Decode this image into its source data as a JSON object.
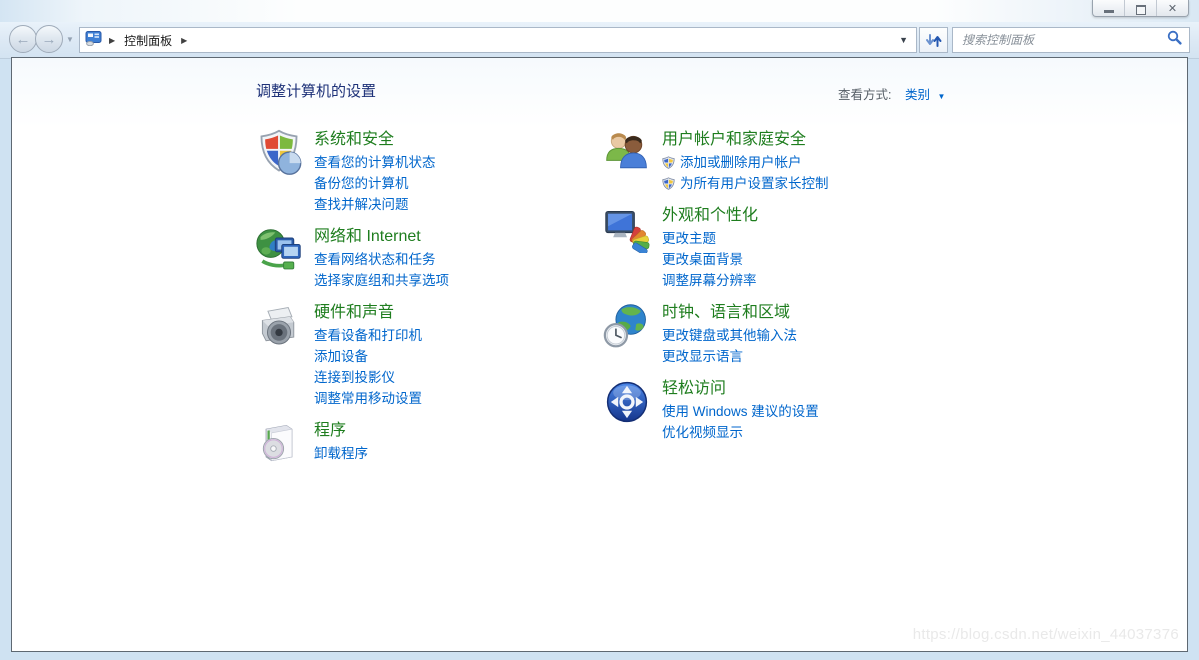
{
  "navbar": {
    "breadcrumb": {
      "label": "控制面板"
    },
    "search_placeholder": "搜索控制面板"
  },
  "content": {
    "title": "调整计算机的设置",
    "view_by_label": "查看方式:",
    "view_by_value": "类别"
  },
  "chrome_icons": [
    "minimize-icon",
    "maximize-icon",
    "close-icon",
    "back-icon",
    "forward-icon",
    "dropdown-chevron-icon",
    "control-panel-icon",
    "breadcrumb-arrow-icon",
    "refresh-icon",
    "search-icon"
  ],
  "categories": {
    "left": [
      {
        "id": "system-and-security",
        "icon": "system-security-shield-icon",
        "title": "系统和安全",
        "links": [
          {
            "label": "查看您的计算机状态"
          },
          {
            "label": "备份您的计算机"
          },
          {
            "label": "查找并解决问题"
          }
        ]
      },
      {
        "id": "network-and-internet",
        "icon": "network-internet-icon",
        "title": "网络和 Internet",
        "links": [
          {
            "label": "查看网络状态和任务"
          },
          {
            "label": "选择家庭组和共享选项"
          }
        ]
      },
      {
        "id": "hardware-and-sound",
        "icon": "hardware-sound-icon",
        "title": "硬件和声音",
        "links": [
          {
            "label": "查看设备和打印机"
          },
          {
            "label": "添加设备"
          },
          {
            "label": "连接到投影仪"
          },
          {
            "label": "调整常用移动设置"
          }
        ]
      },
      {
        "id": "programs",
        "icon": "programs-icon",
        "title": "程序",
        "links": [
          {
            "label": "卸载程序"
          }
        ]
      }
    ],
    "right": [
      {
        "id": "user-accounts-and-family-safety",
        "icon": "user-accounts-icon",
        "title": "用户帐户和家庭安全",
        "links": [
          {
            "label": "添加或删除用户帐户",
            "shield": true
          },
          {
            "label": "为所有用户设置家长控制",
            "shield": true
          }
        ]
      },
      {
        "id": "appearance-and-personalization",
        "icon": "appearance-personalization-icon",
        "title": "外观和个性化",
        "links": [
          {
            "label": "更改主题"
          },
          {
            "label": "更改桌面背景"
          },
          {
            "label": "调整屏幕分辨率"
          }
        ]
      },
      {
        "id": "clock-language-and-region",
        "icon": "clock-language-region-icon",
        "title": "时钟、语言和区域",
        "links": [
          {
            "label": "更改键盘或其他输入法"
          },
          {
            "label": "更改显示语言"
          }
        ]
      },
      {
        "id": "ease-of-access",
        "icon": "ease-of-access-icon",
        "title": "轻松访问",
        "links": [
          {
            "label": "使用 Windows 建议的设置"
          },
          {
            "label": "优化视频显示"
          }
        ]
      }
    ]
  },
  "watermark": "https://blog.csdn.net/weixin_44037376",
  "colors": {
    "category_title_green": "#1e7d1e",
    "task_link_blue": "#0066cc",
    "page_title_navy": "#1d3178"
  }
}
